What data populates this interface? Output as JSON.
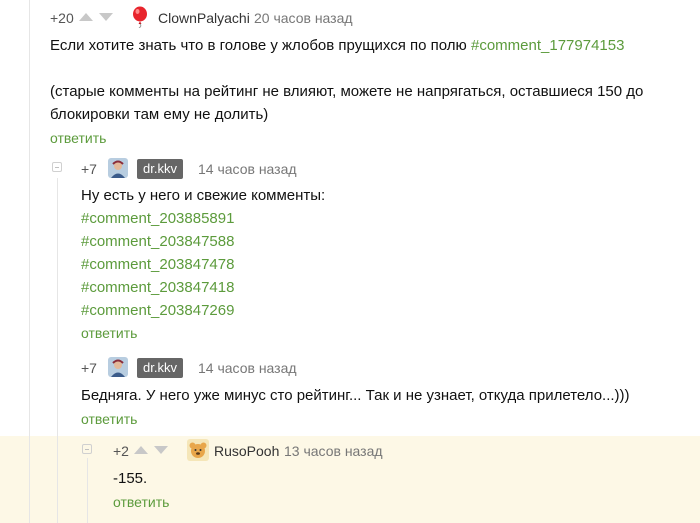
{
  "comment1": {
    "rating": "+20",
    "author": "ClownPalyachi",
    "time": "20 часов назад",
    "text_line1": "Если хотите знать что в голове у жлобов прущихся по полю",
    "link": "#comment_177974153",
    "text_line2": "(старые комменты на рейтинг не влияют, можете не напрягаться, оставшиеся 150 до",
    "text_line3": "блокировки там ему не долить)",
    "reply": "ответить"
  },
  "comment2": {
    "rating": "+7",
    "author": "dr.kkv",
    "time": "14 часов назад",
    "text": "Ну есть у него и свежие комменты:",
    "links": [
      "#comment_203885891",
      "#comment_203847588",
      "#comment_203847478",
      "#comment_203847418",
      "#comment_203847269"
    ],
    "reply": "ответить"
  },
  "comment3": {
    "rating": "+7",
    "author": "dr.kkv",
    "time": "14 часов назад",
    "text": "Бедняга. У него уже минус сто рейтинг... Так и не узнает, откуда прилетело...)))",
    "reply": "ответить"
  },
  "comment4": {
    "rating": "+2",
    "author": "RusoPooh",
    "time": "13 часов назад",
    "text": "-155.",
    "reply": "ответить"
  },
  "colors": {
    "link": "#5c9b3c",
    "highlight_bg": "#fdf8e6",
    "badge_bg": "#666666"
  }
}
